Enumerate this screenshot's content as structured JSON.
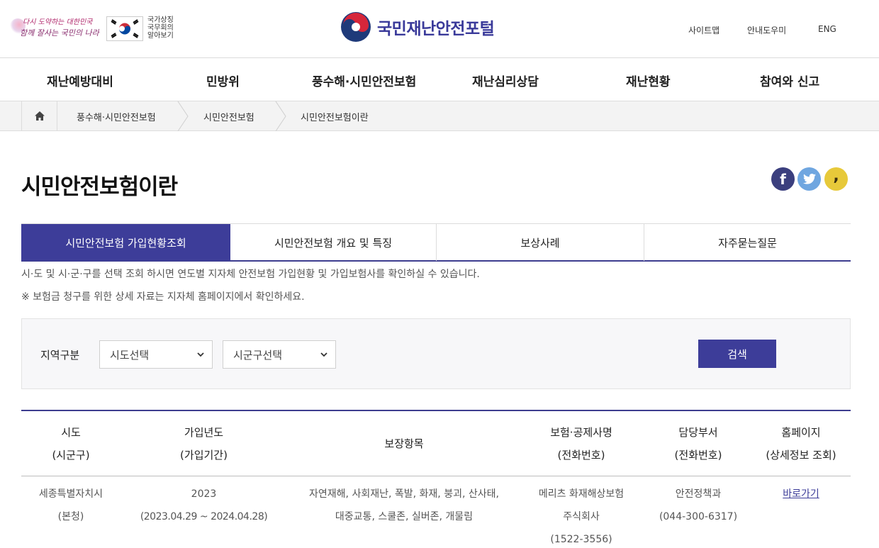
{
  "header": {
    "slogan_line1": "다시 도약하는 대한민국",
    "slogan_line2": "함께 잘사는 국민의 나라",
    "flag_text": "국가상징 국무회의 알아보기",
    "logo_text": "국민재난안전포털",
    "util": [
      "사이트맵",
      "안내도우미",
      "ENG"
    ]
  },
  "gnb": [
    "재난예방대비",
    "민방위",
    "풍수해·시민안전보험",
    "재난심리상담",
    "재난현황",
    "참여와 신고"
  ],
  "breadcrumb": [
    "풍수해·시민안전보험",
    "시민안전보험",
    "시민안전보험이란"
  ],
  "page_title": "시민안전보험이란",
  "share": {
    "facebook": "f",
    "kakao": ","
  },
  "tabs": [
    "시민안전보험 가입현황조회",
    "시민안전보험 개요 및 특징",
    "보상사례",
    "자주묻는질문"
  ],
  "info": [
    "시·도 및 시·군·구를 선택 조회 하시면 연도별 지자체 안전보험 가입현황 및 가입보험사를 확인하실 수 있습니다.",
    "※ 보험금 청구를 위한 상세 자료는 지자체 홈페이지에서 확인하세요."
  ],
  "search": {
    "label": "지역구분",
    "sido": "시도선택",
    "sigungu": "시군구선택",
    "button": "검색"
  },
  "table": {
    "headers": [
      [
        "시도",
        "(시군구)"
      ],
      [
        "가입년도",
        "(가입기간)"
      ],
      [
        "보장항목"
      ],
      [
        "보험·공제사명",
        "(전화번호)"
      ],
      [
        "담당부서",
        "(전화번호)"
      ],
      [
        "홈페이지",
        "(상세정보 조회)"
      ]
    ],
    "rows": [
      {
        "sido": [
          "세종특별자치시",
          "(본청)"
        ],
        "year": [
          "2023",
          "(2023.04.29 ~ 2024.04.28)"
        ],
        "coverage": [
          "자연재해, 사회재난, 폭발, 화재, 붕괴, 산사태,",
          "대중교통, 스쿨존, 실버존, 개물림"
        ],
        "insurer": [
          "메리츠 화재해상보험",
          "주식회사",
          "(1522-3556)"
        ],
        "dept": [
          "안전정책과",
          "(044-300-6317)"
        ],
        "link": "바로가기"
      }
    ]
  },
  "colors": {
    "primary": "#3d3d99",
    "facebook": "#3b5998",
    "twitter": "#55acee",
    "kakao": "#f5c518"
  }
}
